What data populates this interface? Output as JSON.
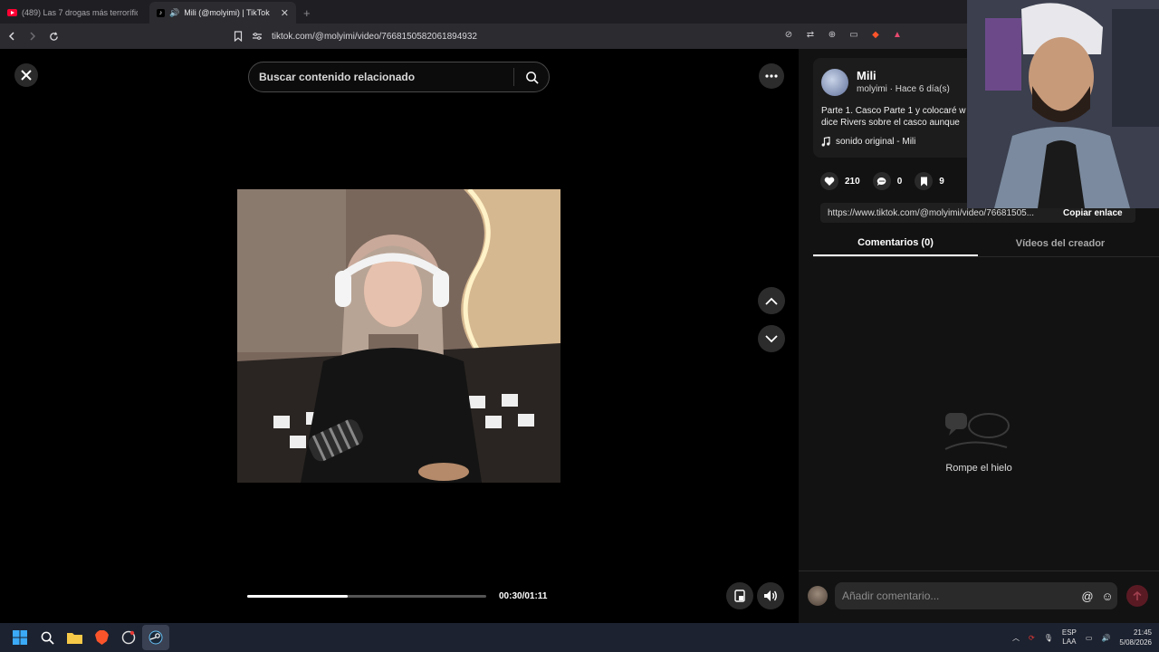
{
  "browser": {
    "tabs": [
      {
        "title": "(489) Las 7 drogas más terroríficas de",
        "active": false,
        "icon": "youtube-icon"
      },
      {
        "title": "Mili (@molyimi) | TikTok",
        "active": true,
        "icon": "tiktok-icon"
      }
    ],
    "new_tab": "+",
    "url": "tiktok.com/@molyimi/video/7668150582061894932"
  },
  "search": {
    "placeholder": "Buscar contenido relacionado"
  },
  "player": {
    "current_time": "00:30/01:11",
    "progress_fraction": 0.42
  },
  "post": {
    "author": "Mili",
    "subtitle": "molyimi · Hace 6 día(s)",
    "description_line1": "Parte 1. Casco Parte 1 y colocaré w",
    "description_line2": "dice Rivers sobre el casco aunque",
    "music": "sonido original - Mili",
    "likes": "210",
    "comments": "0",
    "saves": "9",
    "link": "https://www.tiktok.com/@molyimi/video/76681505...",
    "copy_link_label": "Copiar enlace"
  },
  "panel_tabs": {
    "comments": "Comentarios (0)",
    "creator_videos": "Vídeos del creador"
  },
  "empty_state": "Rompe el hielo",
  "comment_input": {
    "placeholder": "Añadir comentario..."
  },
  "tray": {
    "lang_line1": "ESP",
    "lang_line2": "LAA",
    "time": "21:45",
    "date": "5/08/2026"
  },
  "colors": {
    "background": "#000000",
    "panel": "#121212",
    "accent_red": "#fe2c55"
  }
}
